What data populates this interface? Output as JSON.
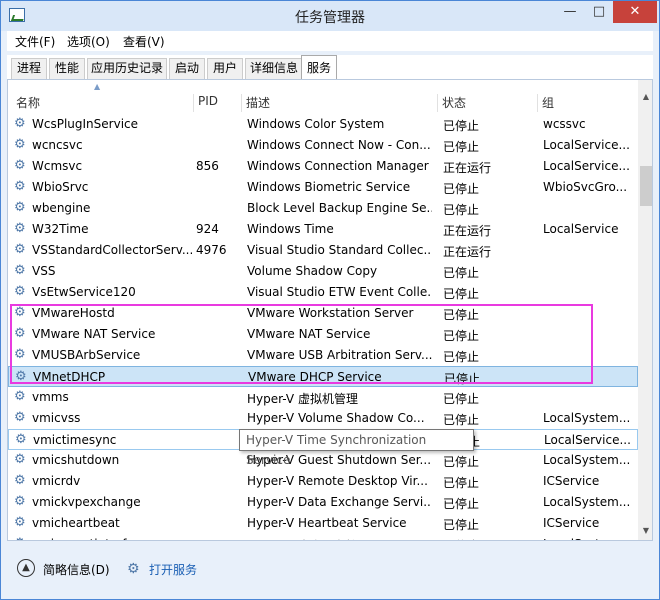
{
  "window": {
    "title": "任务管理器"
  },
  "menu": [
    "文件(F)",
    "选项(O)",
    "查看(V)"
  ],
  "tabs": [
    "进程",
    "性能",
    "应用历史记录",
    "启动",
    "用户",
    "详细信息",
    "服务"
  ],
  "active_tab": "服务",
  "columns": {
    "name": "名称",
    "pid": "PID",
    "desc": "描述",
    "status": "状态",
    "group": "组"
  },
  "rows": [
    {
      "name": "WcsPlugInService",
      "pid": "",
      "desc": "Windows Color System",
      "status": "已停止",
      "group": "wcssvc"
    },
    {
      "name": "wcncsvc",
      "pid": "",
      "desc": "Windows Connect Now - Con...",
      "status": "已停止",
      "group": "LocalService..."
    },
    {
      "name": "Wcmsvc",
      "pid": "856",
      "desc": "Windows Connection Manager",
      "status": "正在运行",
      "group": "LocalService..."
    },
    {
      "name": "WbioSrvc",
      "pid": "",
      "desc": "Windows Biometric Service",
      "status": "已停止",
      "group": "WbioSvcGro..."
    },
    {
      "name": "wbengine",
      "pid": "",
      "desc": "Block Level Backup Engine Se...",
      "status": "已停止",
      "group": ""
    },
    {
      "name": "W32Time",
      "pid": "924",
      "desc": "Windows Time",
      "status": "正在运行",
      "group": "LocalService"
    },
    {
      "name": "VSStandardCollectorServ...",
      "pid": "4976",
      "desc": "Visual Studio Standard Collec...",
      "status": "正在运行",
      "group": ""
    },
    {
      "name": "VSS",
      "pid": "",
      "desc": "Volume Shadow Copy",
      "status": "已停止",
      "group": ""
    },
    {
      "name": "VsEtwService120",
      "pid": "",
      "desc": "Visual Studio ETW Event Colle...",
      "status": "已停止",
      "group": ""
    },
    {
      "name": "VMwareHostd",
      "pid": "",
      "desc": "VMware Workstation Server",
      "status": "已停止",
      "group": ""
    },
    {
      "name": "VMware NAT Service",
      "pid": "",
      "desc": "VMware NAT Service",
      "status": "已停止",
      "group": ""
    },
    {
      "name": "VMUSBArbService",
      "pid": "",
      "desc": "VMware USB Arbitration Serv...",
      "status": "已停止",
      "group": ""
    },
    {
      "name": "VMnetDHCP",
      "pid": "",
      "desc": "VMware DHCP Service",
      "status": "已停止",
      "group": ""
    },
    {
      "name": "vmms",
      "pid": "",
      "desc": "Hyper-V 虚拟机管理",
      "status": "已停止",
      "group": ""
    },
    {
      "name": "vmicvss",
      "pid": "",
      "desc": "Hyper-V Volume Shadow Co...",
      "status": "已停止",
      "group": "LocalSystem..."
    },
    {
      "name": "vmictimesync",
      "pid": "",
      "desc": "",
      "status": "已停止",
      "group": "LocalService..."
    },
    {
      "name": "vmicshutdown",
      "pid": "",
      "desc": "Hyper-V Guest Shutdown Ser...",
      "status": "已停止",
      "group": "LocalSystem..."
    },
    {
      "name": "vmicrdv",
      "pid": "",
      "desc": "Hyper-V Remote Desktop Vir...",
      "status": "已停止",
      "group": "ICService"
    },
    {
      "name": "vmickvpexchange",
      "pid": "",
      "desc": "Hyper-V Data Exchange Servi...",
      "status": "已停止",
      "group": "LocalSystem..."
    },
    {
      "name": "vmicheartbeat",
      "pid": "",
      "desc": "Hyper-V Heartbeat Service",
      "status": "已停止",
      "group": "ICService"
    },
    {
      "name": "vmicguestinterface",
      "pid": "",
      "desc": "Hyper-V 来宾服务接口",
      "status": "已停止",
      "group": "LocalSystem..."
    }
  ],
  "selected_row": "VMnetDHCP",
  "hover_row": "vmictimesync",
  "tooltip": "Hyper-V Time Synchronization Service",
  "footer": {
    "fewer_details": "简略信息(D)",
    "open_services": "打开服务"
  },
  "colors": {
    "selection": "#cce4f7",
    "highlight_box": "#e93ae0",
    "close_button": "#c7423b"
  }
}
